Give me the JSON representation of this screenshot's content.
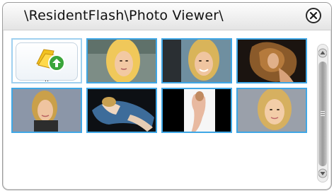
{
  "window": {
    "title": "\\ResidentFlash\\Photo Viewer\\",
    "close_icon": "close-icon"
  },
  "gallery": {
    "upload_item": {
      "icon": "folder-upload-icon",
      "label": ".."
    },
    "photos": [
      {
        "name": "photo-1"
      },
      {
        "name": "photo-2"
      },
      {
        "name": "photo-3"
      },
      {
        "name": "photo-4"
      },
      {
        "name": "photo-5"
      },
      {
        "name": "photo-6"
      },
      {
        "name": "photo-7"
      }
    ]
  },
  "scrollbar": {
    "up_icon": "arrow-up-icon",
    "down_icon": "arrow-down-icon"
  },
  "colors": {
    "accent": "#3fa7e6",
    "title_text": "#111111"
  }
}
